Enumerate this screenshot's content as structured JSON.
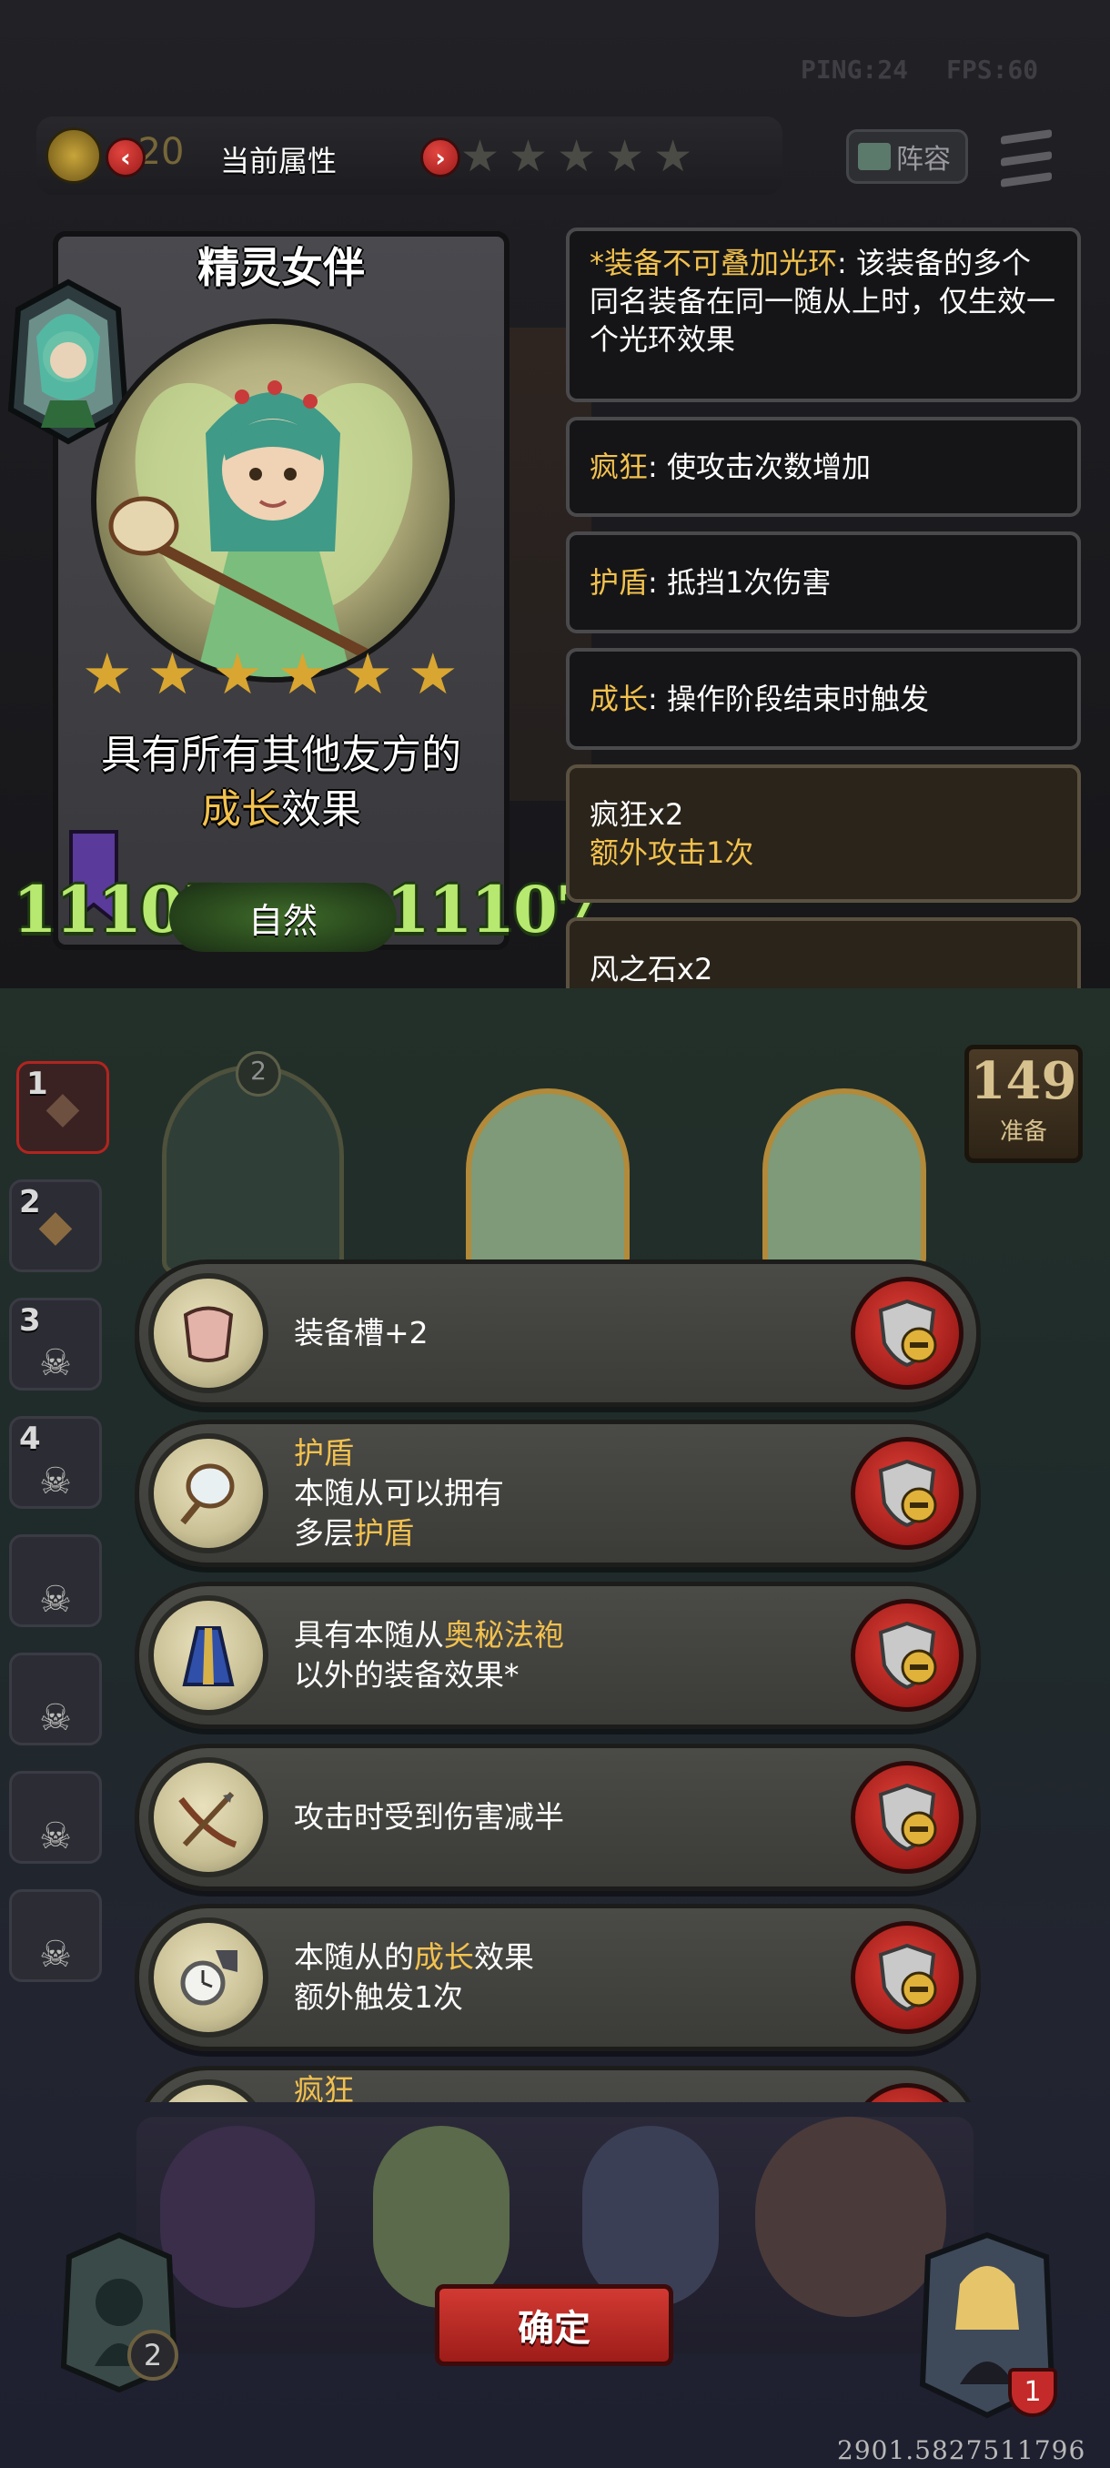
{
  "hud": {
    "ping": "PING:24",
    "fps": "FPS:60"
  },
  "top_bar": {
    "title": "当前属性",
    "gold_delta": "+20",
    "lineup_label": "阵容",
    "star_rating": 5
  },
  "unit_card": {
    "name": "精灵女伴",
    "stars": 6,
    "desc_line1": "具有所有其他友方的",
    "desc_keyword": "成长",
    "desc_tail": "效果",
    "attack": "11107",
    "health": "11107",
    "element": "自然"
  },
  "info_boxes": [
    {
      "keyword": "*装备不可叠加光环",
      "text": ": 该装备的多个同名装备在同一随从上时，仅生效一个光环效果"
    },
    {
      "keyword": "疯狂",
      "text": ": 使攻击次数增加"
    },
    {
      "keyword": "护盾",
      "text": ": 抵挡1次伤害"
    },
    {
      "keyword": "成长",
      "text": ": 操作阶段结束时触发"
    }
  ],
  "equip_boxes": [
    {
      "name": "疯狂x2",
      "effect": "额外攻击1次"
    },
    {
      "name": "风之石x2"
    }
  ],
  "board": {
    "prep_count": "149",
    "prep_label": "准备",
    "slot_numbers": [
      "1",
      "2",
      "3",
      "4"
    ],
    "top_slot_level": "2",
    "hero_level": "2",
    "hp_count": "1",
    "coordinate": "2901.5827511796"
  },
  "equipment_list": [
    {
      "icon": "armor-icon",
      "line1": "装备槽+2"
    },
    {
      "icon": "mirror-icon",
      "kw1": "护盾",
      "line2": "本随从可以拥有",
      "line3a": "多层",
      "kw3": "护盾"
    },
    {
      "icon": "robe-icon",
      "line1a": "具有本随从",
      "kw1": "奥秘法袍",
      "line2": "以外的装备效果*"
    },
    {
      "icon": "crossbow-icon",
      "line1": "攻击时受到伤害减半"
    },
    {
      "icon": "pocket-watch-icon",
      "line1a": "本随从的",
      "kw1": "成长",
      "line1b": "效果",
      "line2": "额外触发1次"
    },
    {
      "icon": "partial-icon",
      "kw1": "疯狂"
    }
  ],
  "confirm_label": "确定",
  "colors": {
    "accent_gold": "#f2c14e",
    "stat_green": "#b7e86f",
    "button_red": "#c8302a"
  }
}
